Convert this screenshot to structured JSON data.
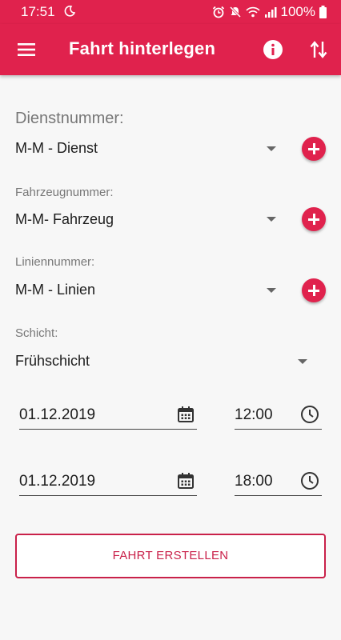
{
  "status_bar": {
    "time": "17:51",
    "battery": "100%",
    "icons": [
      "moon-icon",
      "alarm-icon",
      "mute-icon",
      "wifi-icon",
      "signal-icon",
      "battery-icon"
    ]
  },
  "app_bar": {
    "title": "Fahrt hinterlegen",
    "icons": [
      "menu-icon",
      "info-icon",
      "swap-vert-icon"
    ]
  },
  "form": {
    "dienst": {
      "label": "Dienstnummer:",
      "value": "M-M - Dienst"
    },
    "fahrzeug": {
      "label": "Fahrzeugnummer:",
      "value": "M-M- Fahrzeug"
    },
    "linie": {
      "label": "Liniennummer:",
      "value": "M-M - Linien"
    },
    "schicht": {
      "label": "Schicht:",
      "value": "Frühschicht"
    },
    "start": {
      "date": "01.12.2019",
      "time": "12:00"
    },
    "end": {
      "date": "01.12.2019",
      "time": "18:00"
    }
  },
  "submit_label": "FAHRT ERSTELLEN",
  "colors": {
    "primary": "#e0224d",
    "button_text": "#c9214a",
    "background": "#f7f7f7"
  }
}
